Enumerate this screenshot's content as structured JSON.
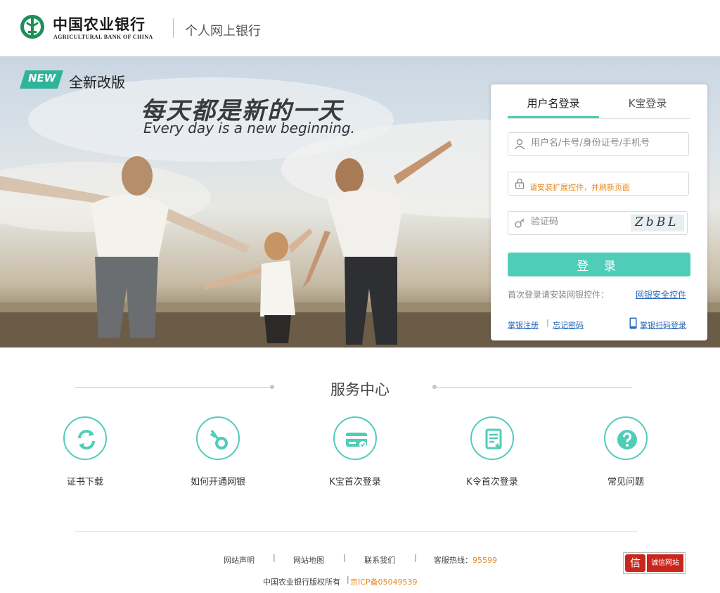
{
  "header": {
    "bank_name_cn": "中国农业银行",
    "bank_name_en": "AGRICULTURAL BANK OF CHINA",
    "section_title": "个人网上银行"
  },
  "banner": {
    "badge": "NEW",
    "version_text": "全新改版",
    "slogan_cn": "每天都是新的一天",
    "slogan_en": "Every day is a new beginning."
  },
  "login": {
    "tabs": [
      {
        "label": "用户名登录",
        "active": true
      },
      {
        "label": "K宝登录",
        "active": false
      }
    ],
    "username_placeholder": "用户名/卡号/身份证号/手机号",
    "password_warning": "请安装扩展控件，并刷新页面",
    "captcha_placeholder": "验证码",
    "captcha_text": "ZbBL",
    "login_button": "登 录",
    "install_tip": "首次登录请安装网银控件：",
    "install_link": "网银安全控件",
    "register_link": "掌银注册",
    "link_separator": "|",
    "forgot_link": "忘记密码",
    "scan_link": "掌银扫码登录"
  },
  "services": {
    "title": "服务中心",
    "items": [
      {
        "label": "证书下载",
        "icon": "refresh-icon"
      },
      {
        "label": "如何开通网银",
        "icon": "key-icon"
      },
      {
        "label": "K宝首次登录",
        "icon": "card-icon"
      },
      {
        "label": "K令首次登录",
        "icon": "document-icon"
      },
      {
        "label": "常见问题",
        "icon": "question-icon"
      }
    ]
  },
  "footer": {
    "links": [
      "网站声明",
      "网站地图",
      "联系我们"
    ],
    "separator": "|",
    "hotline_label": "客服热线：",
    "hotline_number": "95599",
    "copyright": "中国农业银行版权所有",
    "icp_separator": "|",
    "icp": "京ICP备05049539",
    "trust_icon_char": "信",
    "trust_label": "诚信网站"
  },
  "colors": {
    "accent": "#4fcdb9",
    "link": "#2a6ab8",
    "warning": "#e8891f",
    "trust_red": "#c9261c"
  }
}
